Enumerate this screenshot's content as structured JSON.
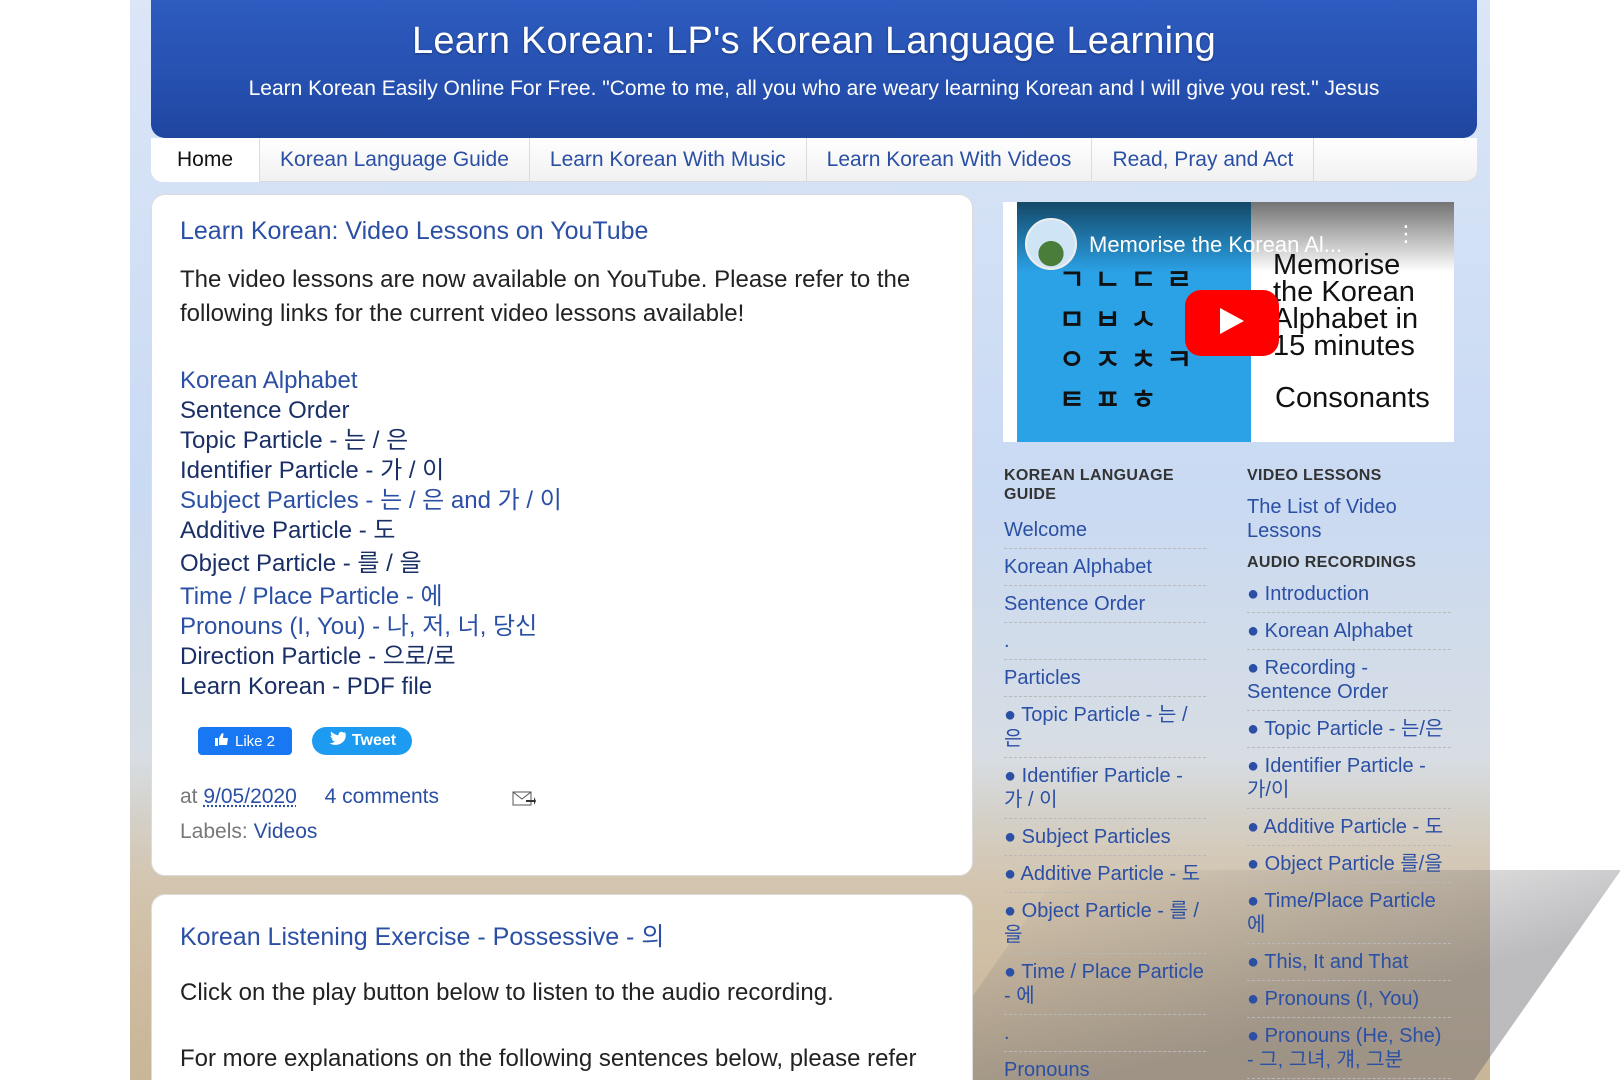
{
  "header": {
    "title": "Learn Korean: LP's Korean Language Learning",
    "description": "Learn Korean Easily Online For Free. \"Come to me, all you who are weary learning Korean and I will give you rest.\" Jesus"
  },
  "tabs": [
    {
      "label": "Home"
    },
    {
      "label": "Korean Language Guide"
    },
    {
      "label": "Learn Korean With Music"
    },
    {
      "label": "Learn Korean With Videos"
    },
    {
      "label": "Read, Pray and Act"
    }
  ],
  "post1": {
    "title": "Learn Korean: Video Lessons on YouTube",
    "body": "The video lessons are now available on YouTube. Please refer to the following links for the current video lessons available!",
    "links": [
      "Korean Alphabet",
      "Sentence Order",
      "Topic Particle - 는 / 은",
      "Identifier Particle - 가 / 이",
      "Subject Particles - 는 / 은 and 가 / 이",
      "Additive Particle - 도",
      "Object Particle - 를 / 을",
      "Time / Place Particle - 에",
      "Pronouns (I, You) - 나, 저, 너, 당신",
      "Direction Particle - 으로/로",
      "Learn Korean - PDF file"
    ],
    "like_label": "Like 2",
    "tweet_label": "Tweet",
    "at_label": "at",
    "date": "9/05/2020",
    "comments": "4 comments",
    "labels_label": "Labels:",
    "label_value": "Videos"
  },
  "post2": {
    "title": "Korean Listening Exercise - Possessive - 의",
    "p1": "Click on the play button below to listen to the audio recording.",
    "p2": "For more explanations on the following sentences below, please refer"
  },
  "video": {
    "title": "Memorise the Korean Al...",
    "hangul": [
      "ㄱㄴㄷㄹ",
      "ㅁㅂㅅ",
      "ㅇㅈㅊㅋ",
      "ㅌㅍㅎ"
    ],
    "thumb_lines": [
      "Memorise",
      "the Korean",
      "Alphabet in",
      "15 minutes"
    ],
    "thumb_sub": "Consonants"
  },
  "sidebar": {
    "col1_heading": "KOREAN LANGUAGE GUIDE",
    "col1_items": [
      "Welcome",
      "Korean Alphabet",
      "Sentence Order",
      ".",
      "Particles",
      "● Topic Particle - 는 / 은",
      "● Identifier Particle - 가 / 이",
      "● Subject Particles",
      "● Additive Particle - 도",
      "● Object Particle - 를 / 을",
      "● Time / Place Particle - 에",
      ".",
      "Pronouns"
    ],
    "col2_heading1": "VIDEO LESSONS",
    "col2_video_link": "The List of Video Lessons",
    "col2_heading2": "AUDIO RECORDINGS",
    "col2_items": [
      "● Introduction",
      "● Korean Alphabet",
      "● Recording - Sentence Order",
      "● Topic Particle - 는/은",
      "● Identifier Particle - 가/이",
      "● Additive Particle - 도",
      "● Object Particle 를/을",
      "● Time/Place Particle 에",
      "● This, It and That",
      "● Pronouns (I, You)",
      "● Pronouns (He, She) - 그, 그녀, 걔, 그분"
    ]
  },
  "colors": {
    "header_blue": "#2650b0",
    "link_blue": "#2a4fa5",
    "youtube_red": "#ff0000"
  }
}
